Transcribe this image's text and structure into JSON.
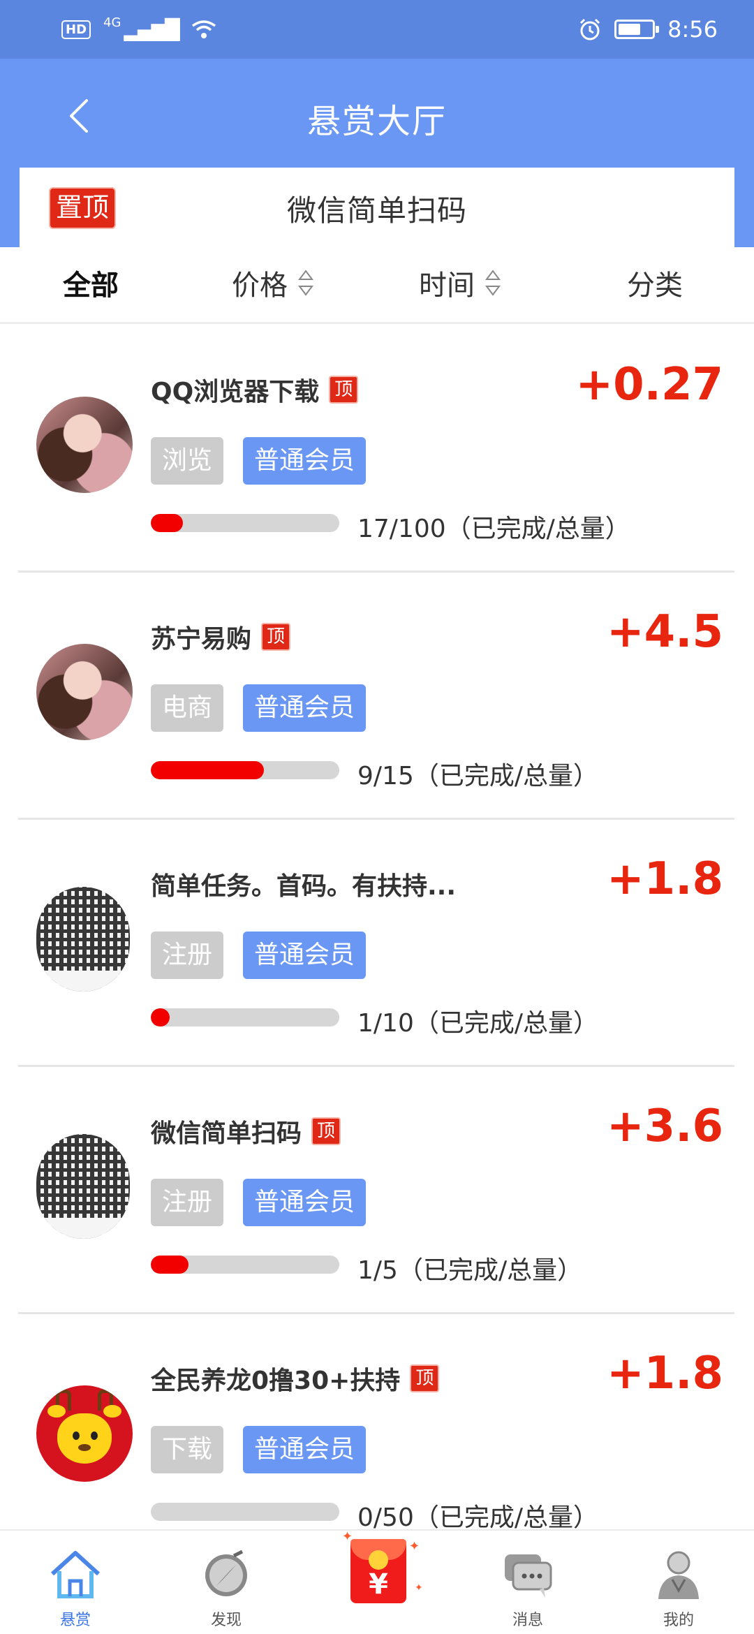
{
  "status_bar": {
    "network": "4G",
    "hd": "HD",
    "time": "8:56"
  },
  "header": {
    "title": "悬赏大厅",
    "back_icon": "chevron-left-icon"
  },
  "pinned": {
    "badge": "置顶",
    "text": "微信简单扫码"
  },
  "filters": [
    {
      "label": "全部",
      "active": true,
      "sortable": false
    },
    {
      "label": "价格",
      "active": false,
      "sortable": true
    },
    {
      "label": "时间",
      "active": false,
      "sortable": true
    },
    {
      "label": "分类",
      "active": false,
      "sortable": false
    }
  ],
  "tasks": [
    {
      "title": "QQ浏览器下载",
      "top_badge": "顶",
      "reward": "+0.27",
      "tags": [
        "浏览",
        "普通会员"
      ],
      "progress_text": "17/100（已完成/总量）",
      "progress": 0.17,
      "avatar": "person"
    },
    {
      "title": "苏宁易购",
      "top_badge": "顶",
      "reward": "+4.5",
      "tags": [
        "电商",
        "普通会员"
      ],
      "progress_text": "9/15（已完成/总量）",
      "progress": 0.6,
      "avatar": "person"
    },
    {
      "title": "简单任务。首码。有扶持...",
      "top_badge": "",
      "reward": "+1.8",
      "tags": [
        "注册",
        "普通会员"
      ],
      "progress_text": "1/10（已完成/总量）",
      "progress": 0.1,
      "avatar": "qr"
    },
    {
      "title": "微信简单扫码",
      "top_badge": "顶",
      "reward": "+3.6",
      "tags": [
        "注册",
        "普通会员"
      ],
      "progress_text": "1/5（已完成/总量）",
      "progress": 0.2,
      "avatar": "qr"
    },
    {
      "title": "全民养龙0撸30+扶持",
      "top_badge": "顶",
      "reward": "+1.8",
      "tags": [
        "下载",
        "普通会员"
      ],
      "progress_text": "0/50（已完成/总量）",
      "progress": 0.0,
      "avatar": "deer"
    }
  ],
  "bottom_nav": {
    "items": [
      {
        "label": "悬赏",
        "icon": "house-icon",
        "active": true
      },
      {
        "label": "发现",
        "icon": "compass-icon",
        "active": false
      },
      {
        "label": "",
        "icon": "red-packet-icon",
        "active": false
      },
      {
        "label": "消息",
        "icon": "chat-icon",
        "active": false
      },
      {
        "label": "我的",
        "icon": "user-icon",
        "active": false
      }
    ],
    "redpacket_symbol": "¥"
  },
  "colors": {
    "header": "#6b97f4",
    "status_bar": "#5b86e0",
    "reward": "#e8260f",
    "badge": "#e02817",
    "progress": "#f20000",
    "tag_blue": "#6b97f4",
    "tag_gray": "#cccccc",
    "nav_active": "#3a74e6"
  }
}
